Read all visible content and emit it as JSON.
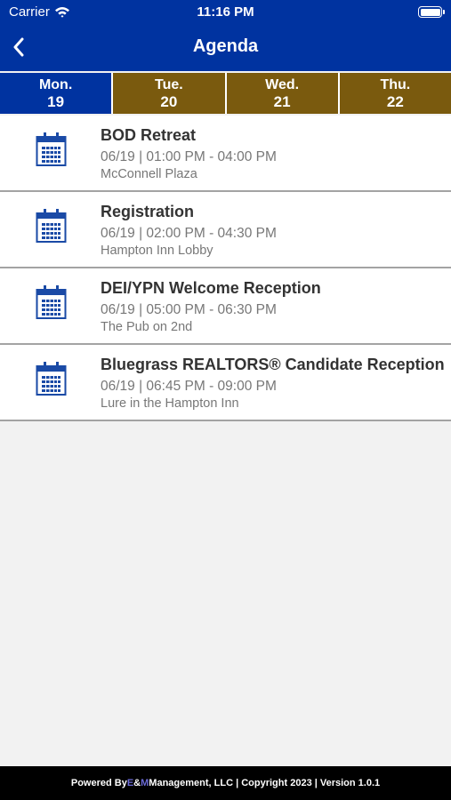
{
  "status_bar": {
    "carrier": "Carrier",
    "time": "11:16 PM",
    "icons": [
      "wifi-icon",
      "battery-icon"
    ]
  },
  "header": {
    "title": "Agenda",
    "back_icon": "chevron-left-icon"
  },
  "tabs": [
    {
      "day": "Mon.",
      "date": "19",
      "active": true
    },
    {
      "day": "Tue.",
      "date": "20",
      "active": false
    },
    {
      "day": "Wed.",
      "date": "21",
      "active": false
    },
    {
      "day": "Thu.",
      "date": "22",
      "active": false
    }
  ],
  "events": [
    {
      "title": "BOD Retreat",
      "time": "06/19 | 01:00 PM - 04:00 PM",
      "location": "McConnell Plaza",
      "icon": "calendar-icon"
    },
    {
      "title": "Registration",
      "time": "06/19 | 02:00 PM - 04:30 PM",
      "location": "Hampton Inn Lobby",
      "icon": "calendar-icon"
    },
    {
      "title": "DEI/YPN Welcome Reception",
      "time": "06/19 | 05:00 PM - 06:30 PM",
      "location": "The Pub on 2nd",
      "icon": "calendar-icon"
    },
    {
      "title": "Bluegrass REALTORS® Candidate Reception",
      "time": "06/19 | 06:45 PM - 09:00 PM",
      "location": "Lure in the Hampton Inn",
      "icon": "calendar-icon"
    }
  ],
  "footer": {
    "prefix": "Powered By ",
    "e": "E",
    "amp": "&",
    "m": "M",
    "rest": " Management, LLC | Copyright 2023 | Version 1.0.1"
  },
  "colors": {
    "header_bg": "#0033a0",
    "tab_active": "#0033a0",
    "tab_inactive": "#7a5a0e",
    "icon": "#1a4aa6",
    "footer_bg": "#000000"
  }
}
